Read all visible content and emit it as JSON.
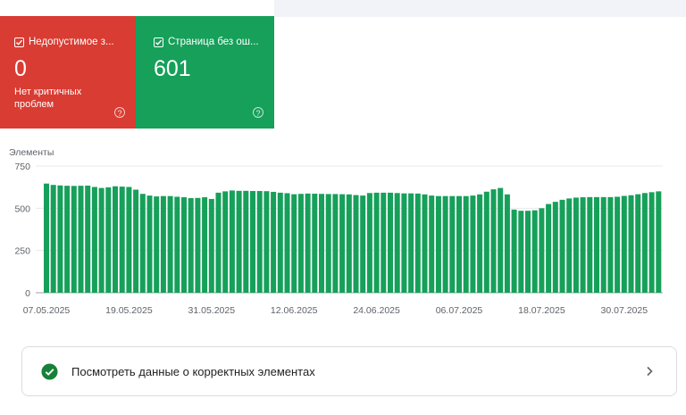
{
  "cards": [
    {
      "title": "Недопустимое з...",
      "value": "0",
      "subtitle": "Нет критичных проблем",
      "help": "?",
      "color": "#d93c32"
    },
    {
      "title": "Страница без ош...",
      "value": "601",
      "subtitle": "",
      "help": "?",
      "color": "#16a05a"
    }
  ],
  "link": {
    "label": "Посмотреть данные о корректных элементах"
  },
  "colors": {
    "bar": "#16a05a",
    "ok_icon": "#188038"
  },
  "icons": {
    "checkbox": "checkbox-checked-icon",
    "help": "help-circle-icon",
    "ok": "check-circle-icon",
    "chevron": "chevron-right-icon"
  },
  "chart_data": {
    "type": "bar",
    "ylabel": "Элементы",
    "ylim": [
      0,
      750
    ],
    "yticks": [
      0,
      250,
      500,
      750
    ],
    "xtick_labels": [
      "07.05.2025",
      "19.05.2025",
      "31.05.2025",
      "12.06.2025",
      "24.06.2025",
      "06.07.2025",
      "18.07.2025",
      "30.07.2025"
    ],
    "grid": true,
    "categories": [
      "07.05.2025",
      "08.05.2025",
      "09.05.2025",
      "10.05.2025",
      "11.05.2025",
      "12.05.2025",
      "13.05.2025",
      "14.05.2025",
      "15.05.2025",
      "16.05.2025",
      "17.05.2025",
      "18.05.2025",
      "19.05.2025",
      "20.05.2025",
      "21.05.2025",
      "22.05.2025",
      "23.05.2025",
      "24.05.2025",
      "25.05.2025",
      "26.05.2025",
      "27.05.2025",
      "28.05.2025",
      "29.05.2025",
      "30.05.2025",
      "31.05.2025",
      "01.06.2025",
      "02.06.2025",
      "03.06.2025",
      "04.06.2025",
      "05.06.2025",
      "06.06.2025",
      "07.06.2025",
      "08.06.2025",
      "09.06.2025",
      "10.06.2025",
      "11.06.2025",
      "12.06.2025",
      "13.06.2025",
      "14.06.2025",
      "15.06.2025",
      "16.06.2025",
      "17.06.2025",
      "18.06.2025",
      "19.06.2025",
      "20.06.2025",
      "21.06.2025",
      "22.06.2025",
      "23.06.2025",
      "24.06.2025",
      "25.06.2025",
      "26.06.2025",
      "27.06.2025",
      "28.06.2025",
      "29.06.2025",
      "30.06.2025",
      "01.07.2025",
      "02.07.2025",
      "03.07.2025",
      "04.07.2025",
      "05.07.2025",
      "06.07.2025",
      "07.07.2025",
      "08.07.2025",
      "09.07.2025",
      "10.07.2025",
      "11.07.2025",
      "12.07.2025",
      "13.07.2025",
      "14.07.2025",
      "15.07.2025",
      "16.07.2025",
      "17.07.2025",
      "18.07.2025",
      "19.07.2025",
      "20.07.2025",
      "21.07.2025",
      "22.07.2025",
      "23.07.2025",
      "24.07.2025",
      "25.07.2025",
      "26.07.2025",
      "27.07.2025",
      "28.07.2025",
      "29.07.2025",
      "30.07.2025",
      "31.07.2025",
      "01.08.2025",
      "02.08.2025",
      "03.08.2025",
      "04.08.2025",
      "05.08.2025",
      "06.08.2025"
    ],
    "values": [
      646,
      638,
      635,
      633,
      632,
      633,
      634,
      626,
      620,
      624,
      630,
      628,
      626,
      610,
      585,
      575,
      570,
      572,
      572,
      568,
      565,
      560,
      561,
      565,
      555,
      592,
      600,
      605,
      603,
      603,
      602,
      602,
      601,
      597,
      592,
      589,
      583,
      585,
      587,
      586,
      585,
      584,
      584,
      583,
      582,
      578,
      575,
      590,
      592,
      592,
      592,
      590,
      588,
      588,
      587,
      582,
      575,
      572,
      572,
      572,
      572,
      572,
      575,
      582,
      598,
      612,
      620,
      582,
      492,
      485,
      485,
      488,
      500,
      525,
      538,
      550,
      558,
      563,
      565,
      566,
      566,
      566,
      566,
      568,
      573,
      577,
      583,
      590,
      595,
      600
    ],
    "series": [
      {
        "name": "",
        "values": []
      }
    ]
  }
}
